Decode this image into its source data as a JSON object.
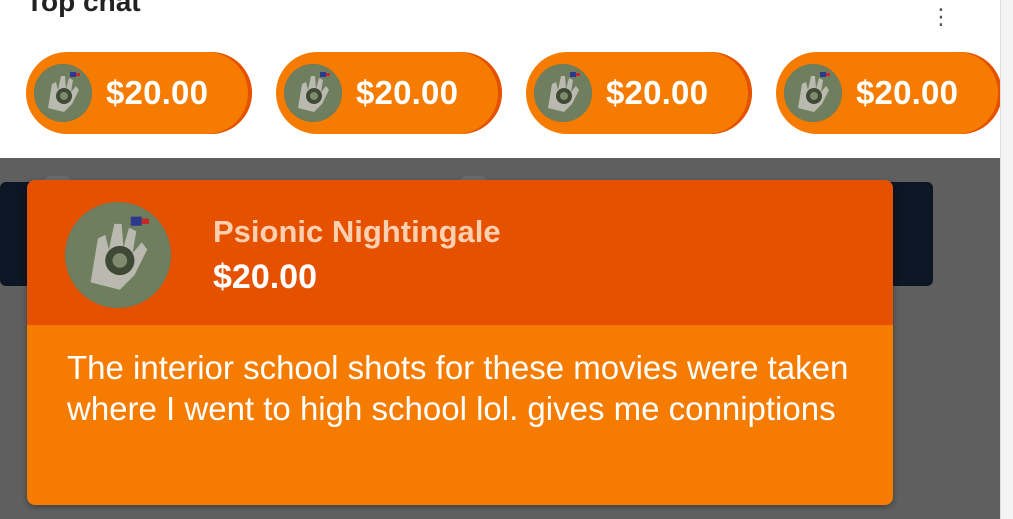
{
  "top_bar": {
    "title": "Top chat",
    "menu_icon": "more-vert-icon"
  },
  "super_chat_chips": [
    {
      "amount": "$20.00",
      "avatar_icon": "glove-avatar-icon"
    },
    {
      "amount": "$20.00",
      "avatar_icon": "glove-avatar-icon"
    },
    {
      "amount": "$20.00",
      "avatar_icon": "glove-avatar-icon"
    },
    {
      "amount": "$20.00",
      "avatar_icon": "glove-avatar-icon"
    }
  ],
  "super_chat_card": {
    "author": "Psionic Nightingale",
    "amount": "$20.00",
    "message": "The interior school shots for these movies were taken where I went to high school lol. gives me conniptions",
    "avatar_icon": "glove-avatar-icon"
  },
  "colors": {
    "chip_bg": "#f57c00",
    "card_header_bg": "#e65100",
    "card_body_bg": "#f57c00",
    "chat_bg": "#5f5f5f",
    "author_color": "#ffd0b0"
  }
}
